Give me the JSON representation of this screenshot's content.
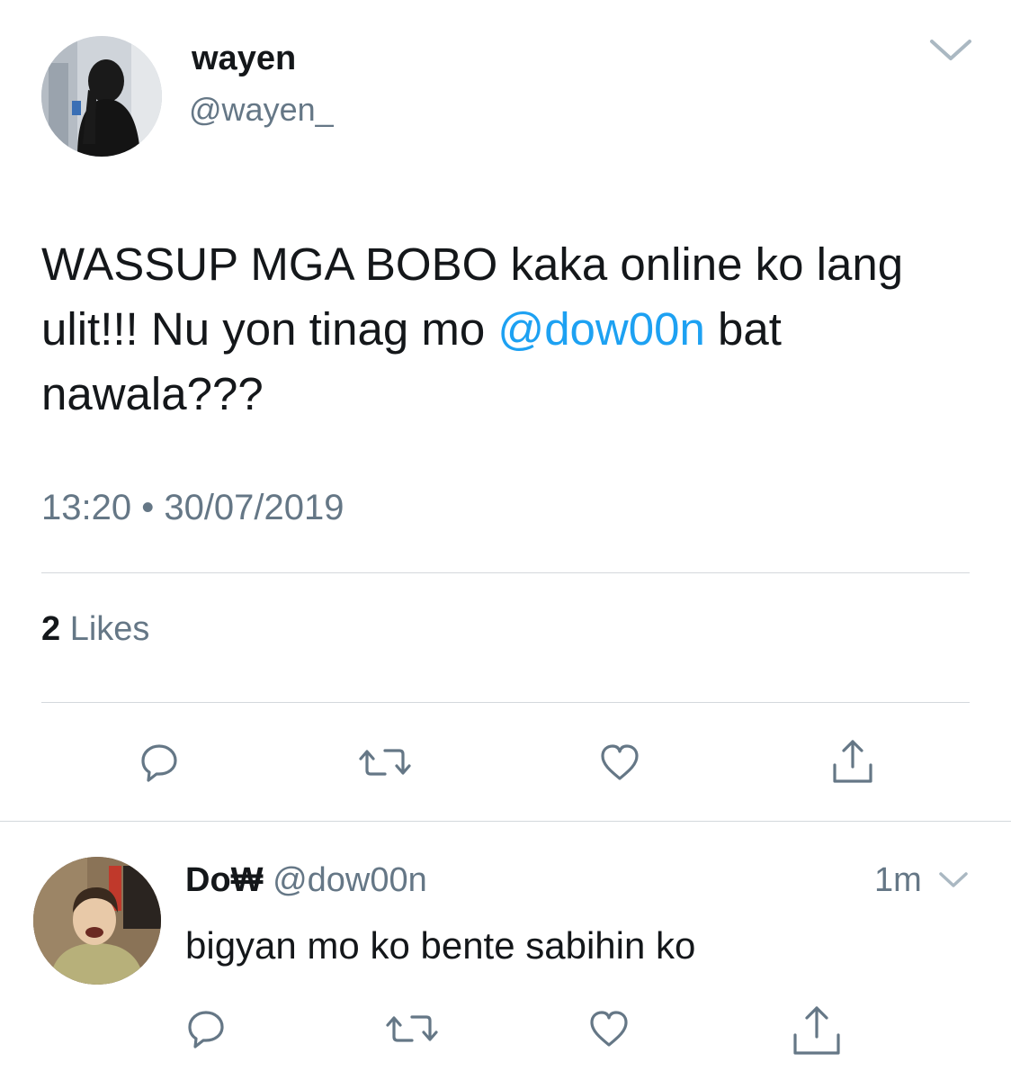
{
  "tweet": {
    "author": {
      "display_name": "wayen",
      "handle": "@wayen_"
    },
    "text_before_mention": "WASSUP MGA BOBO kaka online ko lang ulit!!! Nu yon tinag mo",
    "mention": "@dow00n",
    "text_after_mention": " bat nawala???",
    "timestamp": "13:20 • 30/07/2019",
    "likes_count": "2",
    "likes_label": "Likes",
    "icons": {
      "menu": "chevron-down-icon",
      "reply": "comment-icon",
      "retweet": "retweet-icon",
      "like": "heart-icon",
      "share": "share-icon"
    }
  },
  "reply": {
    "display_name": "Do₩",
    "handle": "@dow00n",
    "time": "1m",
    "text": "bigyan mo ko bente sabihin ko",
    "icons": {
      "menu": "chevron-down-icon",
      "reply": "comment-icon",
      "retweet": "retweet-icon",
      "like": "heart-icon",
      "share": "share-icon"
    }
  },
  "colors": {
    "text": "#14171a",
    "secondary": "#657786",
    "link": "#1da1f2",
    "divider": "#d4d8dc",
    "icon": "#657786"
  }
}
